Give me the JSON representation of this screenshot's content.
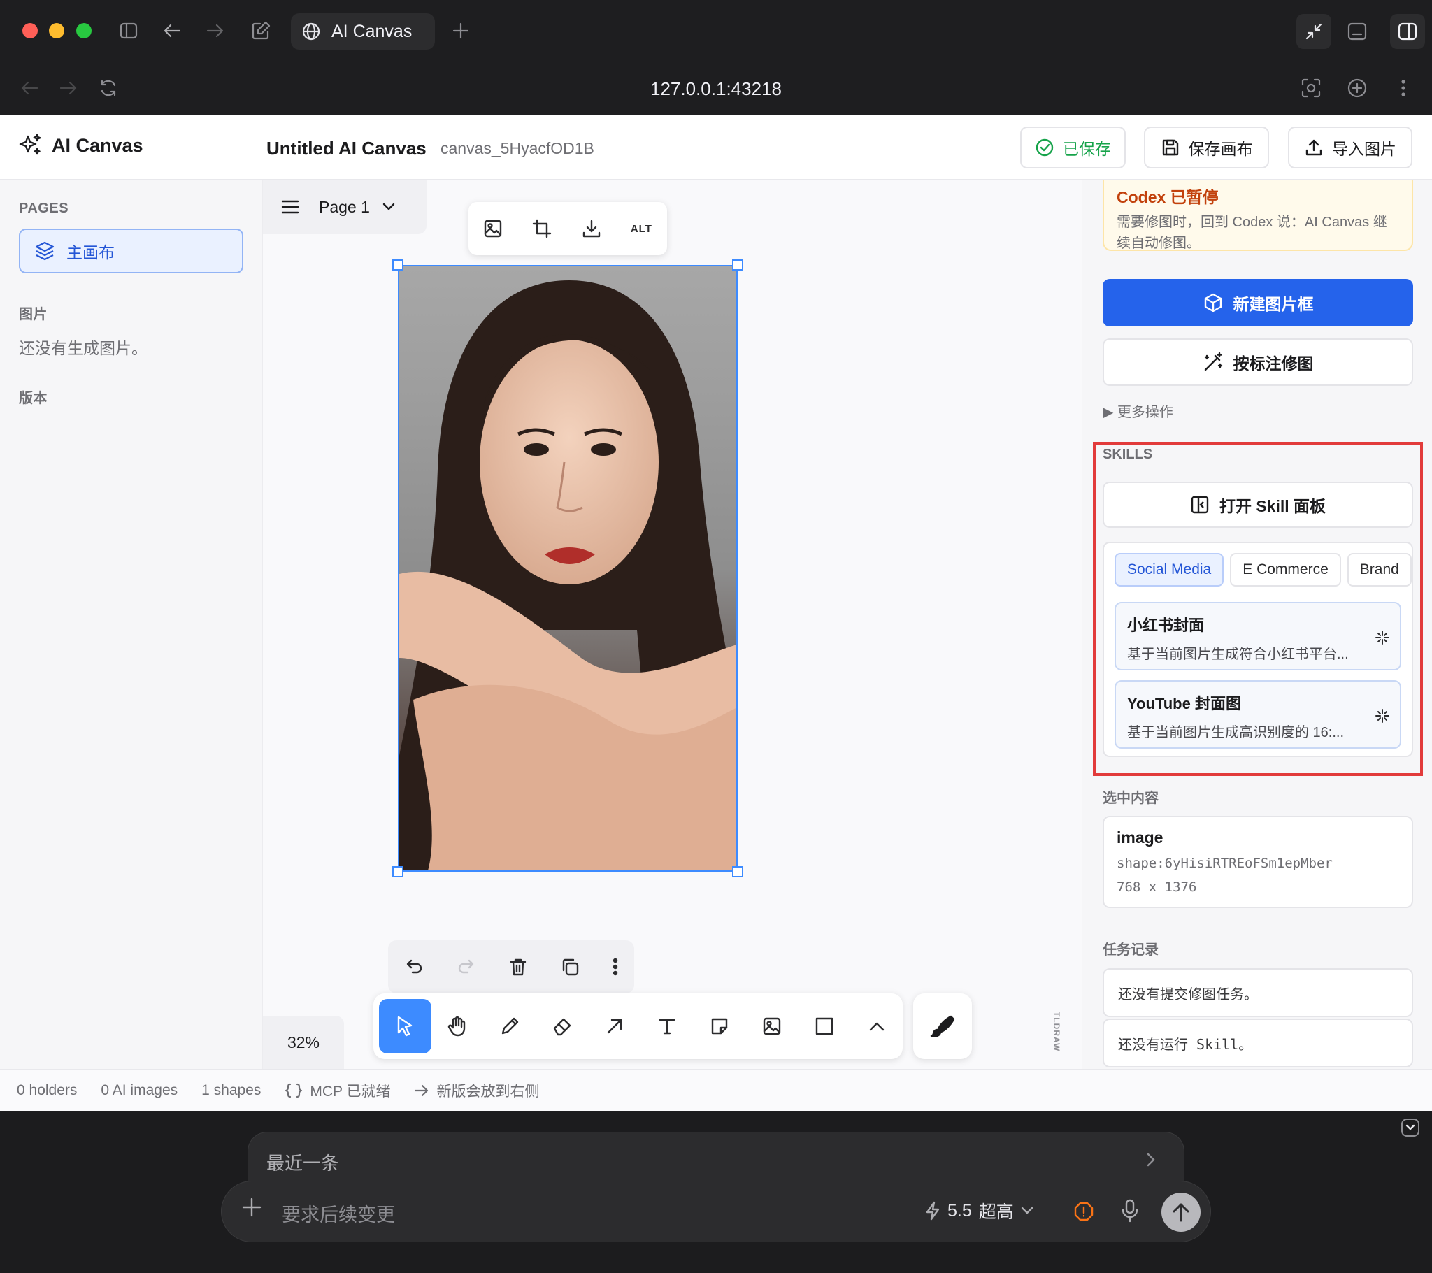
{
  "browser": {
    "tab_title": "AI Canvas",
    "url": "127.0.0.1:43218"
  },
  "header": {
    "brand": "AI Canvas",
    "doc_title": "Untitled AI Canvas",
    "doc_id": "canvas_5HyacfOD1B",
    "saved_label": "已保存",
    "save_label": "保存画布",
    "import_label": "导入图片"
  },
  "sidebar": {
    "pages_label": "PAGES",
    "page_item": "主画布",
    "images_label": "图片",
    "images_empty": "还没有生成图片。",
    "versions_label": "版本"
  },
  "canvas": {
    "page_name": "Page 1",
    "alt_label": "ALT",
    "zoom": "32%",
    "watermark": "TLDRAW"
  },
  "right_panel": {
    "codex_title": "Codex 已暂停",
    "codex_desc": "需要修图时，回到 Codex 说：AI Canvas 继续自动修图。",
    "new_frame": "新建图片框",
    "annotate_edit": "按标注修图",
    "more_actions": "▶ 更多操作",
    "skills_label": "SKILLS",
    "open_skill_panel": "打开 Skill 面板",
    "chips": [
      "Social Media",
      "E Commerce",
      "Brand"
    ],
    "skill_cards": [
      {
        "title": "小红书封面",
        "desc": "基于当前图片生成符合小红书平台..."
      },
      {
        "title": "YouTube 封面图",
        "desc": "基于当前图片生成高识别度的 16:..."
      }
    ],
    "selection_label": "选中内容",
    "selection": {
      "type": "image",
      "shape_id": "shape:6yHisiRTREoFSm1epMber",
      "size": "768 x 1376"
    },
    "tasks_label": "任务记录",
    "task_empty": "还没有提交修图任务。",
    "skill_empty": "还没有运行 Skill。"
  },
  "statusbar": {
    "holders": "0 holders",
    "ai_images": "0 AI images",
    "shapes": "1 shapes",
    "mcp": "MCP 已就绪",
    "next_version": "新版会放到右侧"
  },
  "composer": {
    "recent": "最近一条",
    "placeholder": "要求后续变更",
    "model": "5.5",
    "quality": "超高"
  },
  "colors": {
    "accent": "#2563eb",
    "selection": "#3d8bff",
    "highlight_box": "#e23b3b",
    "saved_green": "#16a34a",
    "codex_title": "#c2410c"
  }
}
